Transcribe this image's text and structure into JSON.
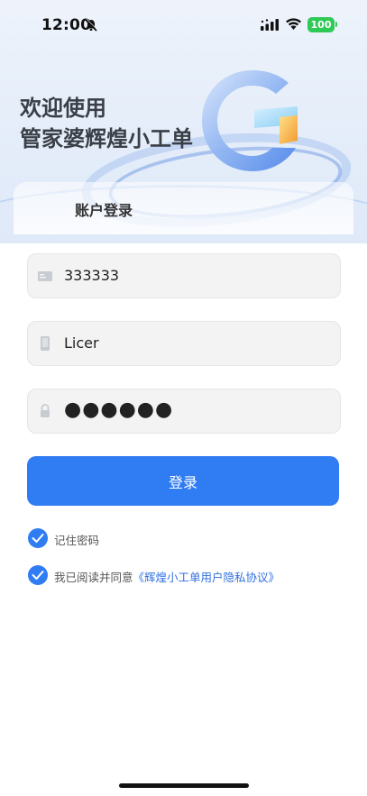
{
  "status_bar": {
    "time": "12:00",
    "battery": "100",
    "icons": [
      "bell-muted-icon",
      "signal-icon",
      "wifi-icon",
      "battery-icon"
    ]
  },
  "hero": {
    "welcome_line1": "欢迎使用",
    "welcome_line2": "管家婆辉煌小工单",
    "logo": "g-logo"
  },
  "card": {
    "title": "账户登录"
  },
  "form": {
    "company_id": {
      "value": "333333",
      "icon": "id-card-icon"
    },
    "username": {
      "value": "Licer",
      "icon": "phone-icon"
    },
    "password": {
      "value": "●●●●●●",
      "icon": "lock-icon"
    }
  },
  "login_button": {
    "label": "登录"
  },
  "options": {
    "remember": {
      "label": "记住密码",
      "checked": true
    },
    "agree": {
      "prefix": "我已阅读并同意",
      "link": "《辉煌小工单用户隐私协议》",
      "checked": true
    }
  },
  "colors": {
    "accent": "#2f7cf3",
    "link": "#2f6fe0",
    "battery": "#2fc956"
  }
}
